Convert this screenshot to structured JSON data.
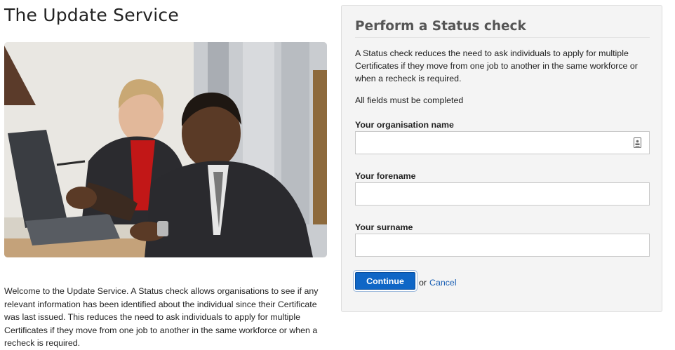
{
  "page": {
    "title": "The Update Service",
    "intro": "Welcome to the Update Service. A Status check allows organisations to see if any relevant information has been identified about the individual since their Certificate was last issued. This reduces the need to ask individuals to apply for multiple Certificates if they move from one job to another in the same workforce or when a recheck is required."
  },
  "status_check": {
    "title": "Perform a Status check",
    "description": "A Status check reduces the need to ask individuals to apply for multiple Certificates if they move from one job to another in the same workforce or when a recheck is required.",
    "note": "All fields must be completed",
    "fields": {
      "organisation": {
        "label": "Your organisation name",
        "value": ""
      },
      "forename": {
        "label": "Your forename",
        "value": ""
      },
      "surname": {
        "label": "Your surname",
        "value": ""
      }
    },
    "continue_label": "Continue",
    "or_text": "or",
    "cancel_label": "Cancel"
  },
  "colors": {
    "button_blue": "#0f66c6",
    "link_blue": "#1a5fb4",
    "panel_bg": "#f4f4f4"
  }
}
